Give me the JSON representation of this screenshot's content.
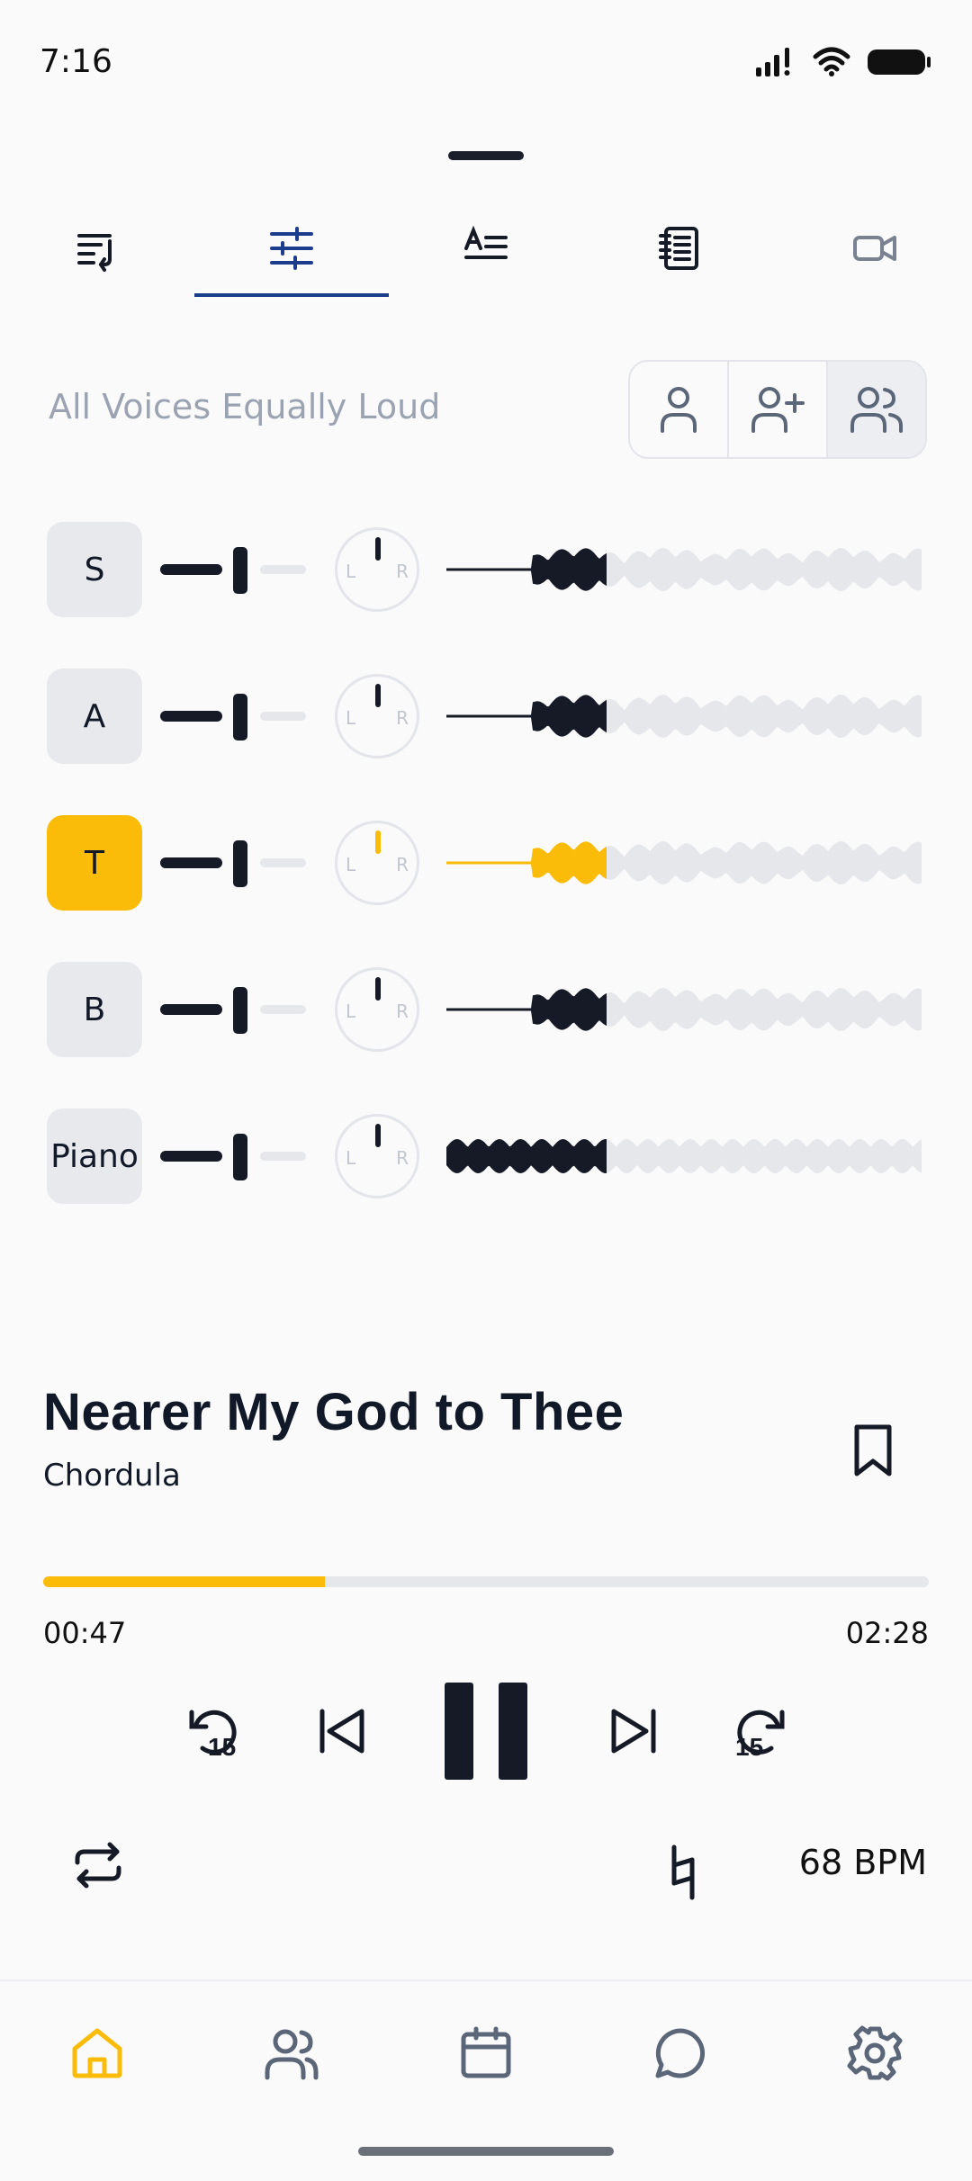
{
  "status": {
    "time": "7:16"
  },
  "tabs": [
    {
      "name": "tab-queue",
      "icon": "playlist-icon",
      "active": false
    },
    {
      "name": "tab-mixer",
      "icon": "sliders-icon",
      "active": true
    },
    {
      "name": "tab-lyrics",
      "icon": "text-icon",
      "active": false
    },
    {
      "name": "tab-score",
      "icon": "notebook-icon",
      "active": false
    },
    {
      "name": "tab-video",
      "icon": "video-icon",
      "active": false
    }
  ],
  "mixer": {
    "mode_label": "All Voices Equally Loud",
    "mode_options": [
      "single-voice-icon",
      "add-voice-icon",
      "all-voices-icon"
    ],
    "mode_selected": 2,
    "tracks": [
      {
        "label": "S",
        "active": false,
        "volume": 0.55,
        "pan": 0.5
      },
      {
        "label": "A",
        "active": false,
        "volume": 0.55,
        "pan": 0.5
      },
      {
        "label": "T",
        "active": true,
        "volume": 0.55,
        "pan": 0.5
      },
      {
        "label": "B",
        "active": false,
        "volume": 0.55,
        "pan": 0.5
      },
      {
        "label": "Piano",
        "active": false,
        "volume": 0.55,
        "pan": 0.5
      }
    ],
    "pan_left": "L",
    "pan_right": "R"
  },
  "song": {
    "title": "Nearer My God to Thee",
    "artist": "Chordula",
    "elapsed": "00:47",
    "duration": "02:28",
    "progress": 0.318,
    "skip_back_seconds": "15",
    "skip_forward_seconds": "15",
    "tempo": "68 BPM"
  },
  "colors": {
    "accent": "#fbbc09",
    "dark": "#151a26",
    "tab_indicator": "#1c3d8c",
    "muted": "#e6e7ea"
  },
  "nav": [
    "home-icon",
    "people-icon",
    "calendar-icon",
    "chat-icon",
    "settings-icon"
  ]
}
